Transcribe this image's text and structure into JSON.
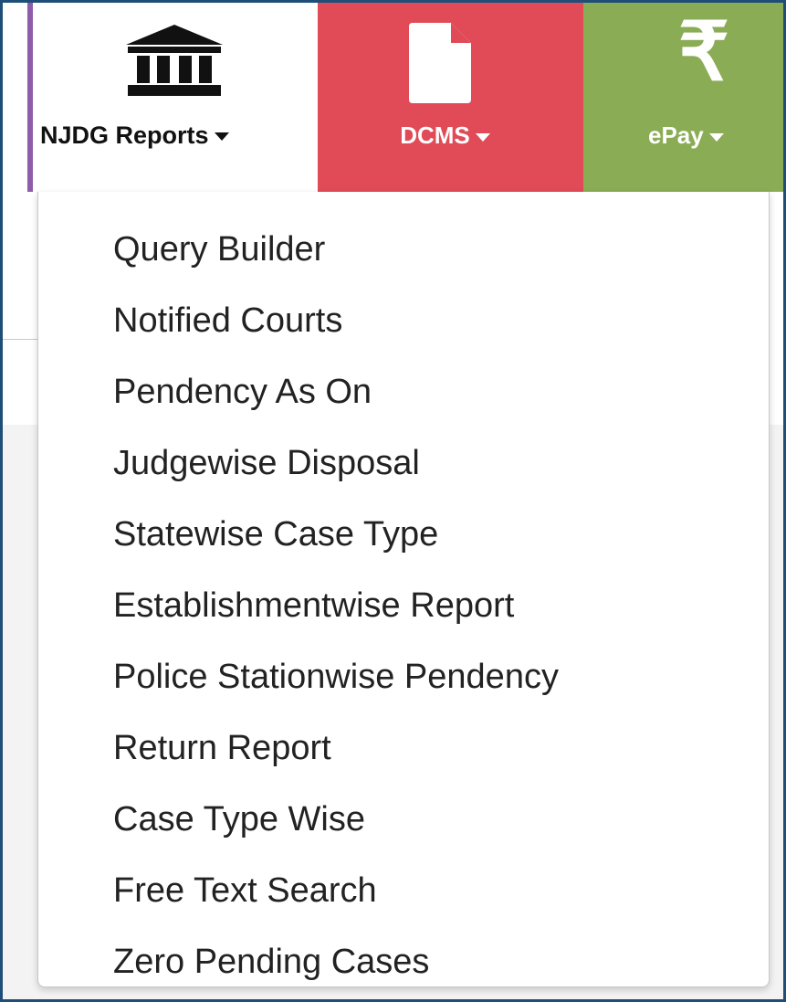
{
  "navbar": {
    "items": [
      {
        "label": "NJDG Reports",
        "icon": "bank-icon",
        "color": "#ffffff",
        "text_color": "#111111"
      },
      {
        "label": "DCMS",
        "icon": "document-icon",
        "color": "#e04b57",
        "text_color": "#ffffff"
      },
      {
        "label": "ePay",
        "icon": "rupee-icon",
        "color": "#8aac55",
        "text_color": "#ffffff"
      }
    ],
    "rupee_symbol": "₹"
  },
  "dropdown": {
    "items": [
      "Query Builder",
      "Notified Courts",
      "Pendency As On",
      "Judgewise Disposal",
      "Statewise Case Type",
      "Establishmentwise Report",
      "Police Stationwise Pendency",
      "Return Report",
      "Case Type Wise",
      "Free Text Search",
      "Zero Pending Cases"
    ]
  },
  "colors": {
    "frame_border": "#1f4e79",
    "accent_purple": "#8e5ca9"
  }
}
